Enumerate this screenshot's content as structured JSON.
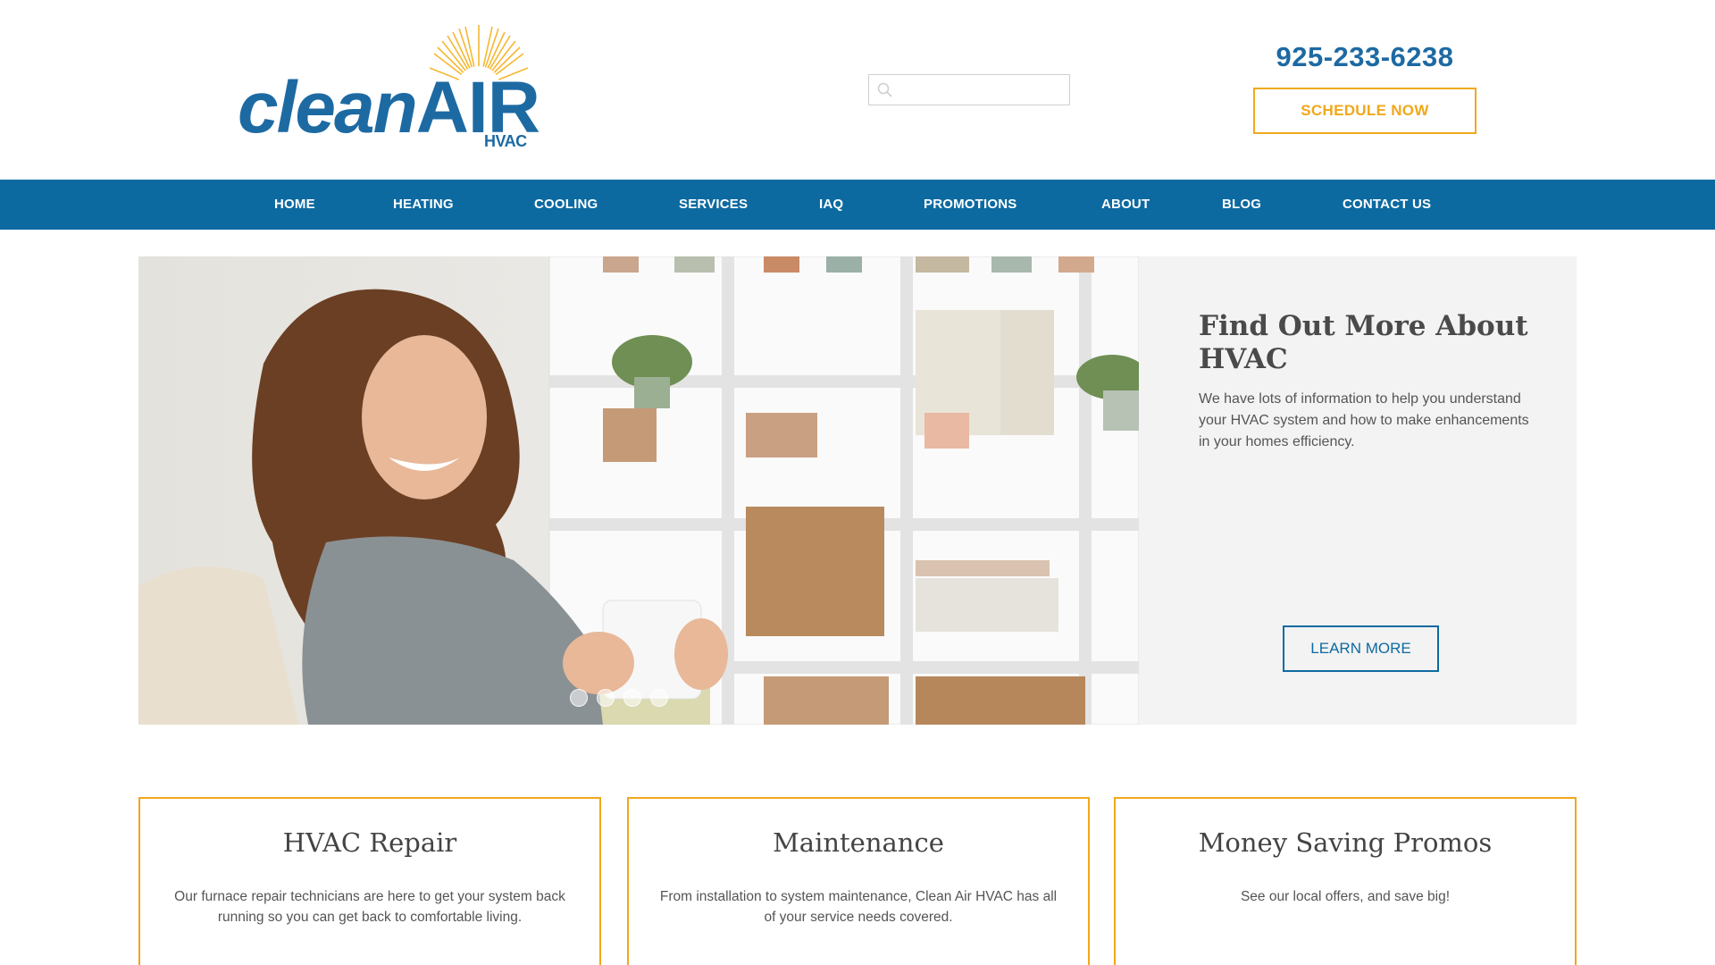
{
  "brand": {
    "logo_word_clean": "clean",
    "logo_word_air": "AIR",
    "logo_sub": "HVAC"
  },
  "search": {
    "placeholder": ""
  },
  "contact": {
    "phone": "925-233-6238",
    "schedule_label": "SCHEDULE NOW"
  },
  "nav": {
    "items": [
      {
        "label": "HOME"
      },
      {
        "label": "HEATING"
      },
      {
        "label": "COOLING"
      },
      {
        "label": "SERVICES"
      },
      {
        "label": "IAQ"
      },
      {
        "label": "PROMOTIONS"
      },
      {
        "label": "ABOUT"
      },
      {
        "label": "BLOG"
      },
      {
        "label": "CONTACT US"
      }
    ]
  },
  "hero": {
    "title": "Find Out More About HVAC",
    "text": "We have lots of information to help you understand your HVAC system and how to make enhancements in your homes efficiency.",
    "button": "LEARN MORE",
    "slide_count": 4,
    "image_icon": "woman-holding-mug-photo"
  },
  "cards": [
    {
      "title": "HVAC Repair",
      "text": "Our furnace repair technicians are here to get your system back running so you can get back to comfortable living."
    },
    {
      "title": "Maintenance",
      "text": "From installation to system maintenance, Clean Air HVAC has all of your service needs covered."
    },
    {
      "title": "Money Saving Promos",
      "text": "See our local offers, and save big!"
    }
  ],
  "colors": {
    "brand_blue": "#0d6aa0",
    "accent_orange": "#f0a81c"
  }
}
